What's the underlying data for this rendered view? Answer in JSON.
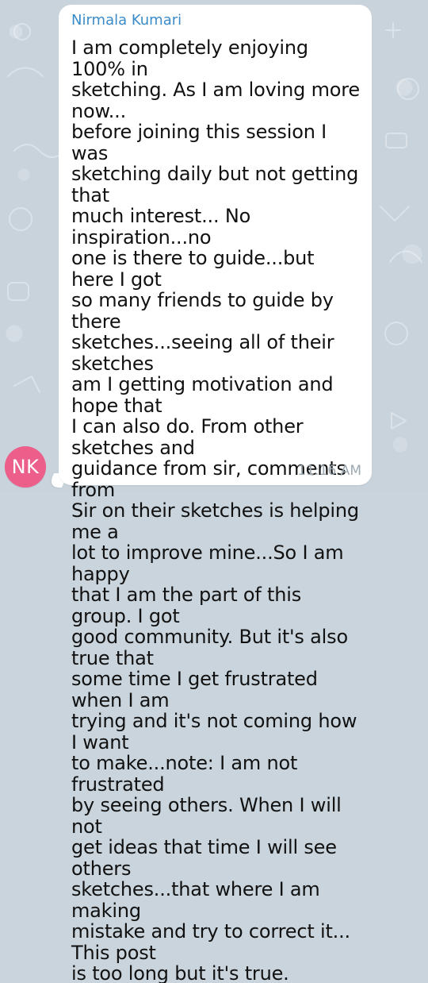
{
  "chat": {
    "avatar_initials": "NK",
    "sender_name": "Nirmala Kumari",
    "message_text": "I am completely enjoying 100% in\nsketching. As I am loving more now...\nbefore joining this session I was\nsketching daily but not getting that\nmuch interest... No inspiration...no\none is there to guide...but here I got\nso many friends to guide by there\nsketches...seeing all of their sketches\nam I getting motivation and hope that\nI can also do. From other sketches and\nguidance from sir, comments from\nSir on their sketches is helping me a\nlot to improve mine...So I am happy\nthat I am the part of this group. I got\ngood community. But it's also true that\nsome time I get frustrated when I am\ntrying and it's not coming how I want\nto make...note: I am not frustrated\nby seeing others. When I will not\nget ideas that time I will see others\nsketches...that where I am making\nmistake and try to correct it... This post\nis too long but it's true.",
    "timestamp": "11:16 AM"
  },
  "colors": {
    "background": "#c8d3dc",
    "bubble": "#ffffff",
    "sender_name": "#3a8bc9",
    "avatar": "#ec5f8a",
    "timestamp": "#9ea9b2",
    "text": "#111111"
  }
}
